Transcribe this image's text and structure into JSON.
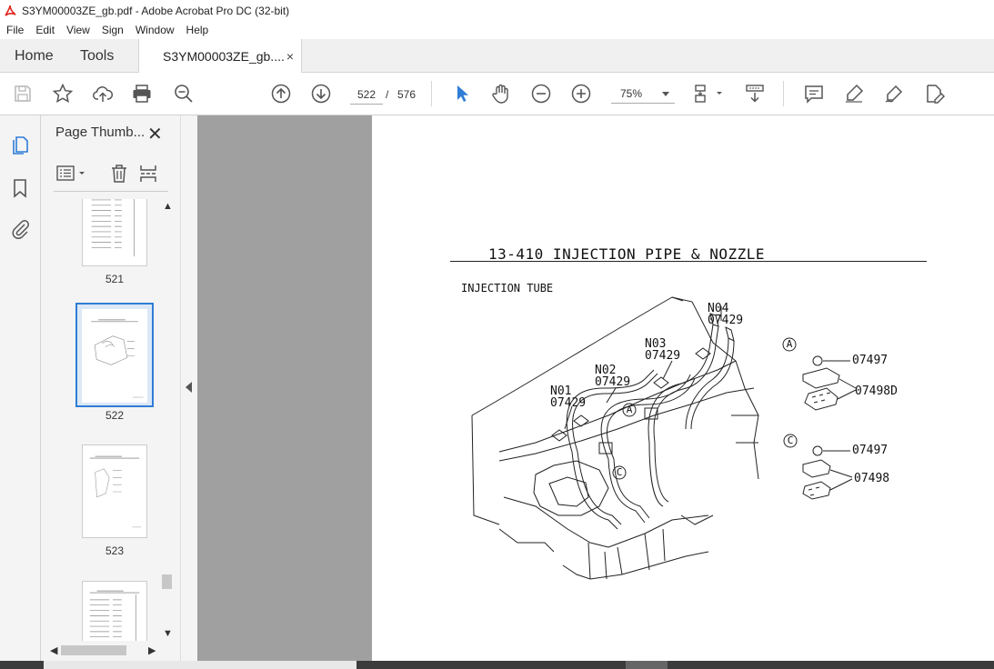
{
  "window": {
    "title": "S3YM00003ZE_gb.pdf - Adobe Acrobat Pro DC (32-bit)"
  },
  "menu": [
    "File",
    "Edit",
    "View",
    "Sign",
    "Window",
    "Help"
  ],
  "tabs": {
    "home": "Home",
    "tools": "Tools",
    "document": "S3YM00003ZE_gb....",
    "close": "×"
  },
  "toolbar": {
    "current_page": "522",
    "page_separator": "/",
    "total_pages": "576",
    "zoom": "75%"
  },
  "thumbnail_panel": {
    "title": "Page Thumb...",
    "close": "✕",
    "thumbnails": [
      {
        "label": "521",
        "selected": false
      },
      {
        "label": "522",
        "selected": true
      },
      {
        "label": "523",
        "selected": false
      },
      {
        "label": "",
        "selected": false
      }
    ]
  },
  "pdf_page": {
    "heading": "13-410  INJECTION PIPE & NOZZLE",
    "subheading": "INJECTION TUBE",
    "callouts": {
      "n04": "N04",
      "n04_part": "07429",
      "n03": "N03",
      "n03_part": "07429",
      "n02": "N02",
      "n02_part": "07429",
      "n01": "N01",
      "n01_part": "07429",
      "marker_a": "A",
      "marker_c": "C",
      "detail_a_label": "A",
      "detail_a_part1": "07497",
      "detail_a_part2": "07498D",
      "detail_c_label": "C",
      "detail_c_part1": "07497",
      "detail_c_part2": "07498"
    }
  },
  "colors": {
    "accent": "#2f7dd6",
    "canvas": "#a0a0a0",
    "app_icon": "#e0231b"
  }
}
